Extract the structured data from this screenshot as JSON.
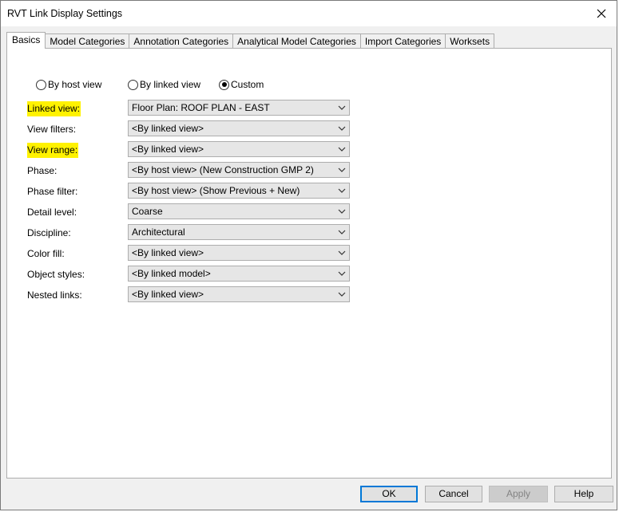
{
  "window": {
    "title": "RVT Link Display Settings"
  },
  "tabs": [
    {
      "label": "Basics",
      "active": true
    },
    {
      "label": "Model Categories",
      "active": false
    },
    {
      "label": "Annotation Categories",
      "active": false
    },
    {
      "label": "Analytical Model Categories",
      "active": false
    },
    {
      "label": "Import Categories",
      "active": false
    },
    {
      "label": "Worksets",
      "active": false
    }
  ],
  "display_mode": {
    "options": [
      "By host view",
      "By linked view",
      "Custom"
    ],
    "selected": "Custom"
  },
  "settings": [
    {
      "label": "Linked view:",
      "value": "Floor Plan: ROOF PLAN - EAST",
      "highlighted": true
    },
    {
      "label": "View filters:",
      "value": "<By linked view>",
      "highlighted": false
    },
    {
      "label": "View range:",
      "value": "<By linked view>",
      "highlighted": true
    },
    {
      "label": "Phase:",
      "value": "<By host view> (New Construction GMP 2)",
      "highlighted": false
    },
    {
      "label": "Phase filter:",
      "value": "<By host view> (Show Previous + New)",
      "highlighted": false
    },
    {
      "label": "Detail level:",
      "value": "Coarse",
      "highlighted": false
    },
    {
      "label": "Discipline:",
      "value": "Architectural",
      "highlighted": false
    },
    {
      "label": "Color fill:",
      "value": "<By linked view>",
      "highlighted": false
    },
    {
      "label": "Object styles:",
      "value": "<By linked model>",
      "highlighted": false
    },
    {
      "label": "Nested links:",
      "value": "<By linked view>",
      "highlighted": false
    }
  ],
  "buttons": {
    "ok": "OK",
    "cancel": "Cancel",
    "apply": "Apply",
    "help": "Help"
  },
  "colors": {
    "highlight": "#fff200",
    "default_button_border": "#0078d7"
  }
}
